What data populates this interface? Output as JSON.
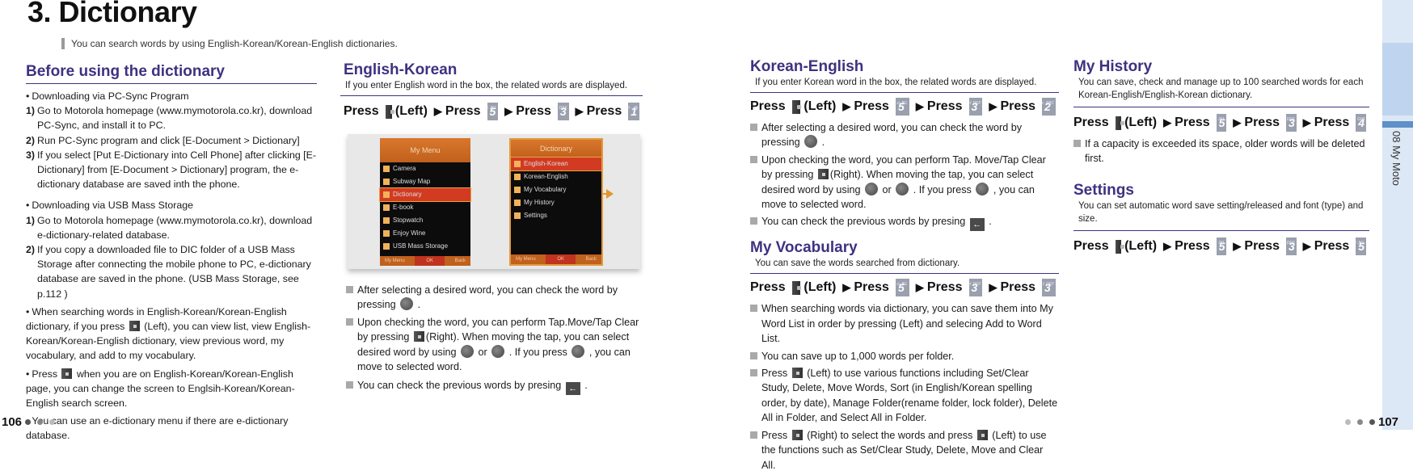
{
  "page": {
    "title": "3. Dictionary",
    "intro": "You can search words by using English-Korean/Korean-English dictionaries.",
    "left_page_number": "106",
    "right_page_number": "107",
    "side_tab_label": "08 My Moto"
  },
  "colors": {
    "heading": "#3d3280",
    "side_tab": "#dde8f6",
    "side_tab_accent": "#5e90c9",
    "key_gray": "#9aa0ad",
    "highlight_orange": "#e2962f"
  },
  "before": {
    "heading": "Before using the dictionary",
    "pc_sync_title": "Downloading via PC-Sync Program",
    "pc_sync_steps": [
      {
        "num": "1)",
        "text": "Go to Motorola homepage (www.mymotorola.co.kr), download PC-Sync, and install it to PC."
      },
      {
        "num": "2)",
        "text": "Run PC-Sync program and click [E-Document > Dictionary]"
      },
      {
        "num": "3)",
        "text": "If you select [Put E-Dictionary into Cell Phone] after clicking [E-Dictionary] from [E-Document > Dictionary] program, the e-dictionary database are saved inth the phone."
      }
    ],
    "usb_title": "Downloading via USB Mass Storage",
    "usb_steps": [
      {
        "num": "1)",
        "text": "Go to Motorola homepage (www.mymotorola.co.kr), download e-dictionary-related database."
      },
      {
        "num": "2)",
        "text": "If you copy a downloaded file to DIC folder of a USB Mass Storage after connecting the mobile phone to PC, e-dictionary database are saved in the phone. (USB Mass Storage, see p.112 )"
      }
    ],
    "note1_a": "When searching words in English-Korean/Korean-English dictionary, if you press",
    "note1_b": "(Left), you can view list, view English-Korean/Korean-English dictionary, view previous word, my vocabulary, and add to my vocabulary.",
    "note2_a": "Press",
    "note2_b": "when you are on English-Korean/Korean-English page, you can change the screen to Englsih-Korean/Korean-English search screen.",
    "note3": "You can use an e-dictionary menu if there are e-dictionary database."
  },
  "press": {
    "word": "Press",
    "left": "(Left)",
    "arrow": "▶"
  },
  "english_korean": {
    "heading": "English-Korean",
    "sub": "If you enter English word in the box, the related words are displayed.",
    "keys": [
      {
        "digit": "5",
        "letters": "ㄹ JKL"
      },
      {
        "digit": "3",
        "letters": "ㅓㅕ DEF"
      },
      {
        "digit": "1",
        "letters": "ㄱㅋ .-@"
      }
    ],
    "screen_left": {
      "header": "My Menu",
      "items": [
        "Camera",
        "Subway Map",
        "Dictionary",
        "E-book",
        "Stopwatch",
        "Enjoy Wine",
        "USB Mass Storage"
      ],
      "selected": "Dictionary",
      "footer": [
        "My Menu",
        "OK",
        "Back"
      ]
    },
    "screen_right": {
      "header": "Dictionary",
      "items": [
        "English-Korean",
        "Korean-English",
        "My Vocabulary",
        "My History",
        "Settings"
      ],
      "selected": "English-Korean",
      "footer": [
        "My Menu",
        "OK",
        "Back"
      ]
    },
    "items": [
      {
        "a": "After selecting a desired word, you can check the word by pressing",
        "b": "."
      },
      {
        "a": "Upon checking the word, you can perform Tap.Move/Tap Clear by pressing",
        "b": "(Right). When moving the tap, you can select desired word by using",
        "c": "or",
        "d": ". If you press",
        "e": ", you can move to selected word."
      },
      {
        "a": "You can check the previous words by presing",
        "b": "."
      }
    ]
  },
  "korean_english": {
    "heading": "Korean-English",
    "sub": "If you enter Korean word in the box, the related words are displayed.",
    "keys": [
      {
        "digit": "5",
        "letters": "ㄹ JKL"
      },
      {
        "digit": "3",
        "letters": "ㅓㅕ DEF"
      },
      {
        "digit": "2",
        "letters": "ㄴㄷ ABC"
      }
    ],
    "items": [
      {
        "a": "After selecting a desired word, you can check the word by pressing",
        "b": "."
      },
      {
        "a": "Upon checking the word, you can perform Tap. Move/Tap Clear by pressing",
        "b": "(Right). When moving the tap, you can select desired word by using",
        "c": "or",
        "d": ". If you press",
        "e": ", you can move to selected word."
      },
      {
        "a": "You can check the previous words by presing",
        "b": "."
      }
    ]
  },
  "my_vocabulary": {
    "heading": "My Vocabulary",
    "sub": "You can save the words searched from dictionary.",
    "keys": [
      {
        "digit": "5",
        "letters": "ㄹ JKL"
      },
      {
        "digit": "3",
        "letters": "ㅓㅕ DEF"
      },
      {
        "digit": "3",
        "letters": "ㅓㅕ DEF"
      }
    ],
    "items": [
      {
        "a": "When searching words via dictionary, you can save them into My Word List in order by pressing (Left) and selecing Add to Word List."
      },
      {
        "a": "You can save up to 1,000 words per folder."
      },
      {
        "a": "Press",
        "b": "(Left) to use various functions including Set/Clear Study, Delete, Move Words, Sort (in English/Korean spelling order, by date), Manage Folder(rename folder, lock folder), Delete All in Folder, and Select All in Folder."
      },
      {
        "a": "Press",
        "b": "(Right) to select the words and press",
        "c": "(Left) to use the functions such as Set/Clear Study, Delete, Move and Clear All."
      }
    ]
  },
  "my_history": {
    "heading": "My History",
    "sub": "You can save, check and manage up to 100 searched words for each Korean-English/English-Korean dictionary.",
    "keys": [
      {
        "digit": "5",
        "letters": "ㄹ JKL"
      },
      {
        "digit": "3",
        "letters": "ㅓㅕ DEF"
      },
      {
        "digit": "4",
        "letters": "ㅅㅈ GHI"
      }
    ],
    "items": [
      {
        "a": "If a capacity is exceeded its space, older words will be deleted first."
      }
    ]
  },
  "settings": {
    "heading": "Settings",
    "sub": "You can set automatic word save setting/released and font (type) and size.",
    "keys": [
      {
        "digit": "5",
        "letters": "ㄹ JKL"
      },
      {
        "digit": "3",
        "letters": "ㅓㅕ DEF"
      },
      {
        "digit": "5",
        "letters": "ㄹ JKL"
      }
    ]
  }
}
